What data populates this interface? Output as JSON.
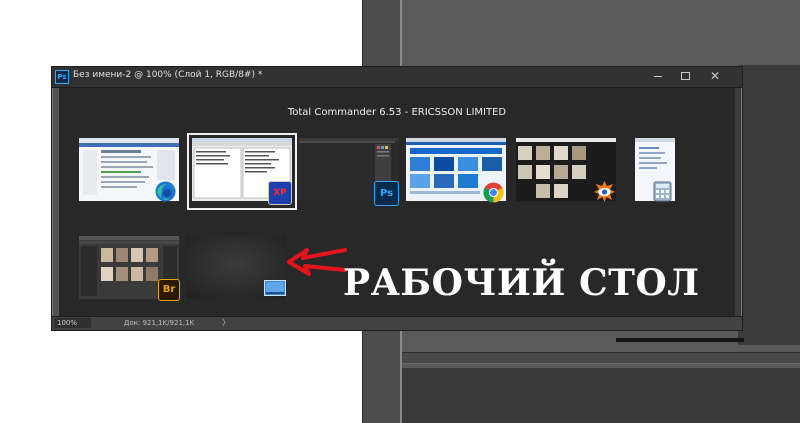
{
  "document_window": {
    "title": "Без имени-2 @ 100% (Слой 1, RGB/8#) *",
    "app_icon": "Ps",
    "controls": [
      "minimize-icon",
      "maximize-icon",
      "close-icon"
    ],
    "status": {
      "zoom": "100%",
      "doc_info": "Док: 921,1K/921,1K",
      "arrow": "〉"
    }
  },
  "switcher": {
    "selected_title": "Total Commander 6.53 - ERICSSON LIMITED",
    "windows": [
      {
        "name": "edge-window",
        "app_icon": "edge-icon"
      },
      {
        "name": "total-commander-window",
        "app_icon": "total-commander-xp-icon",
        "badge_text": "XP",
        "selected": true
      },
      {
        "name": "photoshop-window",
        "app_icon": "photoshop-icon",
        "badge_text": "Ps"
      },
      {
        "name": "chrome-window",
        "app_icon": "chrome-icon"
      },
      {
        "name": "faststone-viewer-window",
        "app_icon": "faststone-eye-icon"
      },
      {
        "name": "calculator-window",
        "app_icon": "calculator-icon"
      },
      {
        "name": "bridge-window",
        "app_icon": "bridge-icon",
        "badge_text": "Br"
      },
      {
        "name": "desktop-window",
        "app_icon": "desktop-icon"
      }
    ]
  },
  "annotation": {
    "label": "РАБОЧИЙ СТОЛ",
    "arrow_color": "#e3141b"
  },
  "colors": {
    "photoshop_blue": "#31a8ff",
    "bridge_orange": "#e8a317",
    "canvas_dark": "#282828"
  }
}
